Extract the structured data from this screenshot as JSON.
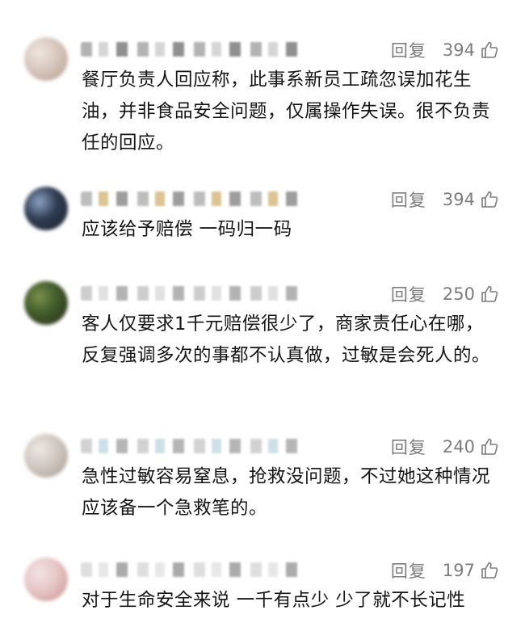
{
  "comments": [
    {
      "reply_label": "回复",
      "likes": "394",
      "text": "餐厅负责人回应称，此事系新员工疏忽误加花生油，并非食品安全问题，仅属操作失误。很不负责任的回应。",
      "avatar_colors": [
        "#d6c7be",
        "#efe6e0",
        "#b79b8c"
      ],
      "name_colors": [
        "#9a9a9a",
        "#c9c9c9",
        "#6b6b6b"
      ]
    },
    {
      "reply_label": "回复",
      "likes": "394",
      "text": "应该给予赔偿 一码归一码",
      "avatar_colors": [
        "#2e3a4f",
        "#8aa1c2",
        "#1c2330"
      ],
      "name_colors": [
        "#a8a8a8",
        "#d0b070",
        "#7d7d7d"
      ]
    },
    {
      "reply_label": "回复",
      "likes": "250",
      "text": "客人仅要求1千元赔偿很少了，商家责任心在哪，反复强调多次的事都不认真做，过敏是会死人的。",
      "avatar_colors": [
        "#3f5a2a",
        "#7a8f4a",
        "#2a2a1c"
      ],
      "name_colors": [
        "#bdbdbd",
        "#d8d8d8",
        "#9a9a9a"
      ]
    },
    {
      "reply_label": "回复",
      "likes": "240",
      "text": "急性过敏容易窒息，抢救没问题，不过她这种情况应该备一个急救笔的。",
      "avatar_colors": [
        "#cfc8c0",
        "#ede8e2",
        "#a69c92"
      ],
      "name_colors": [
        "#c4c4c4",
        "#bcd6e0",
        "#9e9e9e"
      ]
    },
    {
      "reply_label": "回复",
      "likes": "197",
      "text": "对于生命安全来说 一千有点少 少了就不长记性",
      "avatar_colors": [
        "#e7c6c6",
        "#f3e2e2",
        "#c98f8f"
      ],
      "name_colors": [
        "#d4d4d4",
        "#e0e0e0",
        "#8f8f8f"
      ]
    }
  ]
}
